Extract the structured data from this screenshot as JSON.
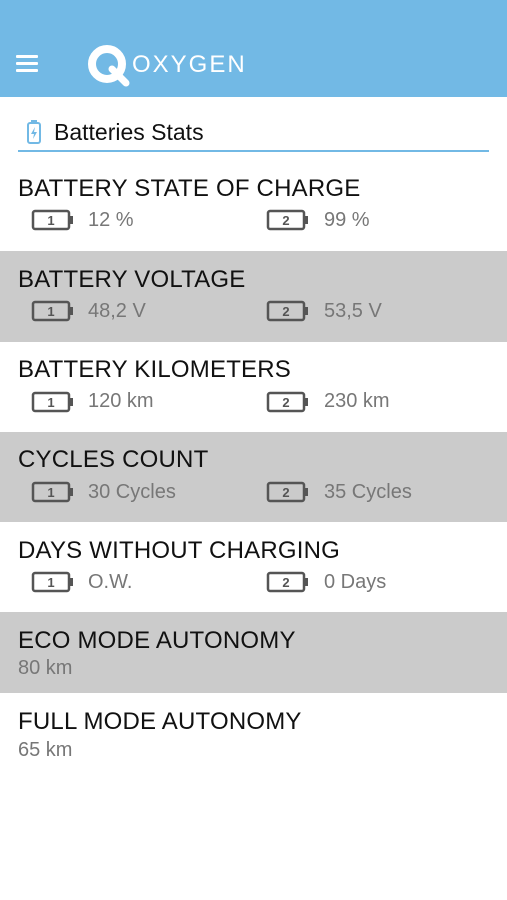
{
  "header": {
    "brand": "OXYGEN",
    "accent_color": "#72b9e5"
  },
  "section": {
    "title": "Batteries Stats",
    "icon": "battery-icon"
  },
  "stats": [
    {
      "title": "BATTERY STATE OF CHARGE",
      "b1": "12 %",
      "b2": "99 %"
    },
    {
      "title": "BATTERY VOLTAGE",
      "b1": "48,2 V",
      "b2": "53,5 V"
    },
    {
      "title": "BATTERY KILOMETERS",
      "b1": "120 km",
      "b2": "230 km"
    },
    {
      "title": "CYCLES COUNT",
      "b1": "30 Cycles",
      "b2": "35 Cycles"
    },
    {
      "title": "DAYS WITHOUT CHARGING",
      "b1": "O.W.",
      "b2": "0 Days"
    },
    {
      "title": "ECO MODE AUTONOMY",
      "value": "80 km"
    },
    {
      "title": "FULL MODE AUTONOMY",
      "value": "65 km"
    }
  ],
  "battery_labels": {
    "one": "1",
    "two": "2"
  }
}
